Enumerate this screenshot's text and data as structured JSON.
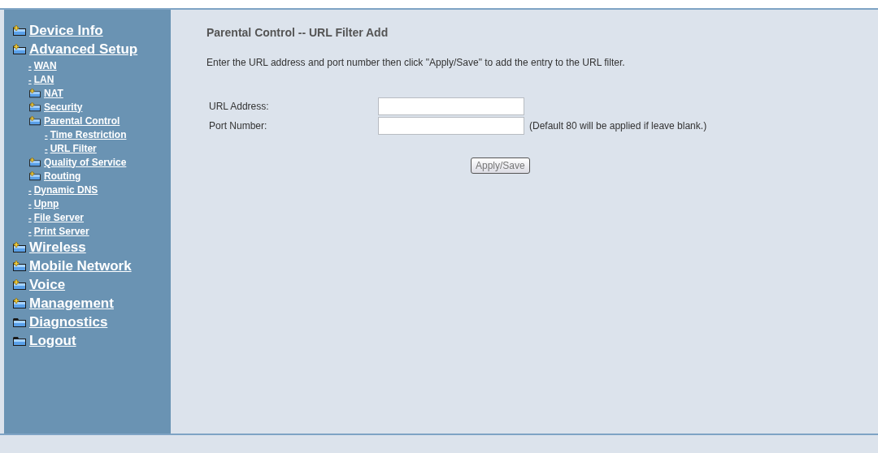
{
  "sidebar": {
    "items": [
      {
        "label": "Device Info",
        "kind": "folder-plus"
      },
      {
        "label": "Advanced Setup",
        "kind": "folder-plus",
        "children": [
          {
            "label": "WAN",
            "kind": "leaf",
            "marker": "-"
          },
          {
            "label": "LAN",
            "kind": "leaf",
            "marker": "-"
          },
          {
            "label": "NAT",
            "kind": "folder-plus"
          },
          {
            "label": "Security",
            "kind": "folder-plus"
          },
          {
            "label": "Parental Control",
            "kind": "folder-plus",
            "children": [
              {
                "label": "Time Restriction",
                "kind": "leaf",
                "marker": "-"
              },
              {
                "label": "URL Filter",
                "kind": "leaf",
                "marker": "-"
              }
            ]
          },
          {
            "label": "Quality of Service",
            "kind": "folder-plus"
          },
          {
            "label": "Routing",
            "kind": "folder-plus"
          },
          {
            "label": "Dynamic DNS",
            "kind": "leaf",
            "marker": "-"
          },
          {
            "label": "Upnp",
            "kind": "leaf",
            "marker": "-"
          },
          {
            "label": "File Server",
            "kind": "leaf",
            "marker": "-"
          },
          {
            "label": "Print Server",
            "kind": "leaf",
            "marker": "-"
          }
        ]
      },
      {
        "label": "Wireless",
        "kind": "folder-plus"
      },
      {
        "label": "Mobile Network",
        "kind": "folder-plus"
      },
      {
        "label": "Voice",
        "kind": "folder-plus"
      },
      {
        "label": "Management",
        "kind": "folder-plus"
      },
      {
        "label": "Diagnostics",
        "kind": "folder"
      },
      {
        "label": "Logout",
        "kind": "folder"
      }
    ]
  },
  "content": {
    "title": "Parental Control -- URL Filter Add",
    "description": "Enter the URL address and port number then click \"Apply/Save\" to add the entry to the URL filter.",
    "fields": [
      {
        "label": "URL Address:"
      },
      {
        "label": "Port Number:",
        "note": "(Default 80 will be applied if leave blank.)"
      }
    ],
    "button": "Apply/Save"
  }
}
